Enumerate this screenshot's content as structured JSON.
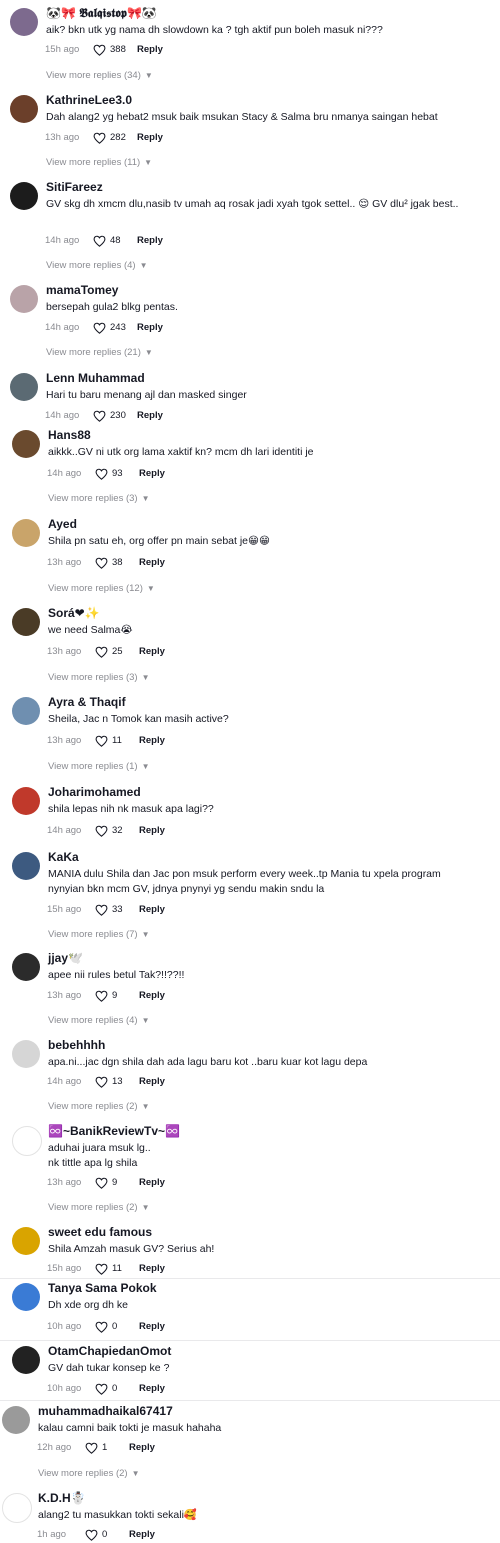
{
  "comments": [
    {
      "user": "🐼🎀 𝕭𝖆𝖑𝖖𝖎𝖘𝖙𝖔𝖕🎀🐼",
      "text": "aik? bkn utk yg nama dh slowdown ka ? tgh aktif pun boleh masuk ni???",
      "time": "15h ago",
      "likes": "388",
      "reply": "Reply",
      "more": "View more replies (34)",
      "color": "#7d6a8e"
    },
    {
      "user": "KathrineLee3.0",
      "text": "Dah alang2 yg hebat2 msuk baik msukan Stacy & Salma bru nmanya saingan hebat",
      "time": "13h ago",
      "likes": "282",
      "reply": "Reply",
      "more": "View more replies (11)",
      "color": "#6b3f2a"
    },
    {
      "user": "SitiFareez",
      "text": "GV skg dh xmcm dlu,nasib tv umah aq rosak jadi xyah tgok settel.. 😌 GV dlu² jgak best..",
      "time": "14h ago",
      "likes": "48",
      "reply": "Reply",
      "more": "View more replies (4)",
      "color": "#1c1c1c"
    },
    {
      "user": "mamaTomey",
      "text": "bersepah gula2 blkg pentas.",
      "time": "14h ago",
      "likes": "243",
      "reply": "Reply",
      "more": "View more replies (21)",
      "color": "#b9a3a8"
    },
    {
      "user": "Lenn Muhammad",
      "text": "Hari tu baru menang ajl dan masked singer",
      "time": "14h ago",
      "likes": "230",
      "reply": "Reply",
      "more": "",
      "color": "#5b6a73"
    },
    {
      "user": "Hans88",
      "text": "aikkk..GV ni utk org lama xaktif kn? mcm dh lari identiti je",
      "time": "14h ago",
      "likes": "93",
      "reply": "Reply",
      "more": "View more replies (3)",
      "color": "#6a4a2e"
    },
    {
      "user": "Ayed",
      "text": "Shila pn satu eh, org offer pn main sebat je😁😁",
      "time": "13h ago",
      "likes": "38",
      "reply": "Reply",
      "more": "View more replies (12)",
      "color": "#c9a46a"
    },
    {
      "user": "Sorá❤✨",
      "text": "we need Salma😭",
      "time": "13h ago",
      "likes": "25",
      "reply": "Reply",
      "more": "View more replies (3)",
      "color": "#4a3b26"
    },
    {
      "user": "Ayra & Thaqif",
      "text": "Sheila, Jac n Tomok kan masih active?",
      "time": "13h ago",
      "likes": "11",
      "reply": "Reply",
      "more": "View more replies (1)",
      "color": "#6f8fb0"
    },
    {
      "user": "Joharimohamed",
      "text": "shila lepas nih nk masuk apa lagi??",
      "time": "14h ago",
      "likes": "32",
      "reply": "Reply",
      "more": "",
      "color": "#c0392b"
    },
    {
      "user": "KaKa",
      "text": "MANIA dulu Shila dan Jac pon msuk perform every week..tp Mania tu xpela program nynyian bkn mcm GV, jdnya pnynyi yg sendu makin sndu la",
      "time": "15h ago",
      "likes": "33",
      "reply": "Reply",
      "more": "View more replies (7)",
      "color": "#3d5a80"
    },
    {
      "user": "jjay🕊️",
      "text": "apee nii rules betul Tak?!!??!!",
      "time": "13h ago",
      "likes": "9",
      "reply": "Reply",
      "more": "View more replies (4)",
      "color": "#2b2b2b"
    },
    {
      "user": "bebehhhh",
      "text": "apa.ni...jac dgn shila dah ada lagu baru kot ..baru kuar kot lagu depa",
      "time": "14h ago",
      "likes": "13",
      "reply": "Reply",
      "more": "View more replies (2)",
      "color": "#d6d6d6"
    },
    {
      "user": "♾️~BanikReviewTv~♾️",
      "text": "aduhai juara msuk lg..\nnk tittle apa lg shila",
      "time": "13h ago",
      "likes": "9",
      "reply": "Reply",
      "more": "View more replies (2)",
      "color": "#ffffff"
    },
    {
      "user": "sweet edu famous",
      "text": "Shila Amzah masuk GV? Serius ah!",
      "time": "15h ago",
      "likes": "11",
      "reply": "Reply",
      "more": "",
      "color": "#d9a400"
    },
    {
      "user": "Tanya Sama Pokok",
      "text": "Dh xde org dh ke",
      "time": "10h ago",
      "likes": "0",
      "reply": "Reply",
      "more": "",
      "color": "#3a7bd5"
    },
    {
      "user": "OtamChapiedanOmot",
      "text": "GV dah tukar konsep ke ?",
      "time": "10h ago",
      "likes": "0",
      "reply": "Reply",
      "more": "",
      "color": "#222222"
    },
    {
      "user": "muhammadhaikal67417",
      "text": "kalau camni baik tokti je masuk hahaha",
      "time": "12h ago",
      "likes": "1",
      "reply": "Reply",
      "more": "View more replies (2)",
      "color": "#9a9a9a"
    },
    {
      "user": "K.D.H☃️",
      "text": "alang2 tu masukkan tokti sekali🥰",
      "time": "1h ago",
      "likes": "0",
      "reply": "Reply",
      "more": "",
      "color": "#ffffff"
    }
  ]
}
